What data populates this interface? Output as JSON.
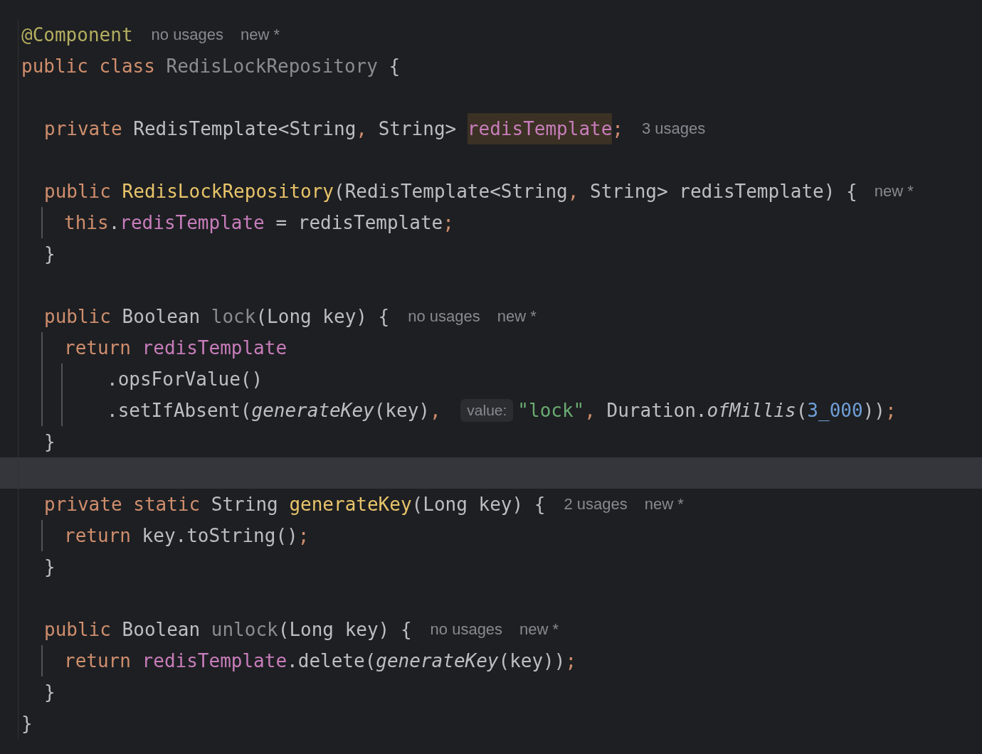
{
  "lines": [
    {
      "kind": "line",
      "tokens": [
        {
          "kind": "ann",
          "text": "@Component"
        },
        {
          "kind": "usage",
          "text": "no usages"
        },
        {
          "kind": "author",
          "text": "new *"
        }
      ]
    },
    {
      "kind": "line",
      "tokens": [
        {
          "kind": "kw",
          "text": "public "
        },
        {
          "kind": "kw",
          "text": "class "
        },
        {
          "kind": "unused",
          "text": "RedisLockRepository "
        },
        {
          "kind": "plain",
          "text": "{"
        }
      ],
      "children": [
        {
          "kind": "blank",
          "current": false
        },
        {
          "kind": "line",
          "tokens": [
            {
              "kind": "kw",
              "text": "private "
            },
            {
              "kind": "plain",
              "text": "RedisTemplate<String"
            },
            {
              "kind": "punct",
              "text": ", "
            },
            {
              "kind": "plain",
              "text": "String> "
            },
            {
              "kind": "field",
              "text": "redisTemplate",
              "highlighted": true
            },
            {
              "kind": "punct",
              "text": ";"
            },
            {
              "kind": "usage",
              "text": "3 usages"
            }
          ]
        },
        {
          "kind": "blank",
          "current": false
        },
        {
          "kind": "line",
          "tokens": [
            {
              "kind": "kw",
              "text": "public "
            },
            {
              "kind": "decl",
              "text": "RedisLockRepository"
            },
            {
              "kind": "plain",
              "text": "(RedisTemplate<String"
            },
            {
              "kind": "punct",
              "text": ", "
            },
            {
              "kind": "plain",
              "text": "String> redisTemplate) {"
            },
            {
              "kind": "author",
              "text": "new *"
            }
          ],
          "children": [
            {
              "kind": "line",
              "tokens": [
                {
                  "kind": "kw",
                  "text": "this"
                },
                {
                  "kind": "plain",
                  "text": "."
                },
                {
                  "kind": "field",
                  "text": "redisTemplate",
                  "highlighted": false
                },
                {
                  "kind": "plain",
                  "text": " = redisTemplate"
                },
                {
                  "kind": "punct",
                  "text": ";"
                }
              ]
            }
          ]
        },
        {
          "kind": "line",
          "tokens": [
            {
              "kind": "plain",
              "text": "}"
            }
          ]
        },
        {
          "kind": "blank",
          "current": false
        },
        {
          "kind": "line",
          "tokens": [
            {
              "kind": "kw",
              "text": "public "
            },
            {
              "kind": "plain",
              "text": "Boolean "
            },
            {
              "kind": "unused",
              "text": "lock"
            },
            {
              "kind": "plain",
              "text": "(Long key) {"
            },
            {
              "kind": "usage",
              "text": "no usages"
            },
            {
              "kind": "author",
              "text": "new *"
            }
          ],
          "children": [
            {
              "kind": "line",
              "tokens": [
                {
                  "kind": "kw",
                  "text": "return "
                },
                {
                  "kind": "field",
                  "text": "redisTemplate",
                  "highlighted": false
                }
              ],
              "continuation": true,
              "children": [
                {
                  "kind": "line",
                  "tokens": [
                    {
                      "kind": "plain",
                      "text": ".opsForValue()"
                    }
                  ]
                },
                {
                  "kind": "line",
                  "tokens": [
                    {
                      "kind": "plain",
                      "text": ".setIfAbsent("
                    },
                    {
                      "kind": "italic",
                      "text": "generateKey"
                    },
                    {
                      "kind": "plain",
                      "text": "(key)"
                    },
                    {
                      "kind": "punct",
                      "text": ", "
                    },
                    {
                      "kind": "inlay",
                      "text": "value:"
                    },
                    {
                      "kind": "str",
                      "text": "\"lock\""
                    },
                    {
                      "kind": "punct",
                      "text": ", "
                    },
                    {
                      "kind": "plain",
                      "text": "Duration."
                    },
                    {
                      "kind": "italic",
                      "text": "ofMillis"
                    },
                    {
                      "kind": "plain",
                      "text": "("
                    },
                    {
                      "kind": "num",
                      "text": "3_000"
                    },
                    {
                      "kind": "plain",
                      "text": "))"
                    },
                    {
                      "kind": "punct",
                      "text": ";"
                    }
                  ]
                }
              ]
            }
          ]
        },
        {
          "kind": "line",
          "tokens": [
            {
              "kind": "plain",
              "text": "}"
            }
          ]
        },
        {
          "kind": "blank",
          "current": true
        },
        {
          "kind": "line",
          "tokens": [
            {
              "kind": "kw",
              "text": "private "
            },
            {
              "kind": "kw",
              "text": "static "
            },
            {
              "kind": "plain",
              "text": "String "
            },
            {
              "kind": "decl",
              "text": "generateKey"
            },
            {
              "kind": "plain",
              "text": "(Long key) {"
            },
            {
              "kind": "usage",
              "text": "2 usages"
            },
            {
              "kind": "author",
              "text": "new *"
            }
          ],
          "children": [
            {
              "kind": "line",
              "tokens": [
                {
                  "kind": "kw",
                  "text": "return "
                },
                {
                  "kind": "plain",
                  "text": "key.toString()"
                },
                {
                  "kind": "punct",
                  "text": ";"
                }
              ]
            }
          ]
        },
        {
          "kind": "line",
          "tokens": [
            {
              "kind": "plain",
              "text": "}"
            }
          ]
        },
        {
          "kind": "blank",
          "current": false
        },
        {
          "kind": "line",
          "tokens": [
            {
              "kind": "kw",
              "text": "public "
            },
            {
              "kind": "plain",
              "text": "Boolean "
            },
            {
              "kind": "unused",
              "text": "unlock"
            },
            {
              "kind": "plain",
              "text": "(Long key) {"
            },
            {
              "kind": "usage",
              "text": "no usages"
            },
            {
              "kind": "author",
              "text": "new *"
            }
          ],
          "children": [
            {
              "kind": "line",
              "tokens": [
                {
                  "kind": "kw",
                  "text": "return "
                },
                {
                  "kind": "field",
                  "text": "redisTemplate",
                  "highlighted": false
                },
                {
                  "kind": "plain",
                  "text": ".delete("
                },
                {
                  "kind": "italic",
                  "text": "generateKey"
                },
                {
                  "kind": "plain",
                  "text": "(key))"
                },
                {
                  "kind": "punct",
                  "text": ";"
                }
              ]
            }
          ]
        },
        {
          "kind": "line",
          "tokens": [
            {
              "kind": "plain",
              "text": "}"
            }
          ]
        }
      ]
    },
    {
      "kind": "line",
      "tokens": [
        {
          "kind": "plain",
          "text": "}"
        }
      ]
    }
  ]
}
